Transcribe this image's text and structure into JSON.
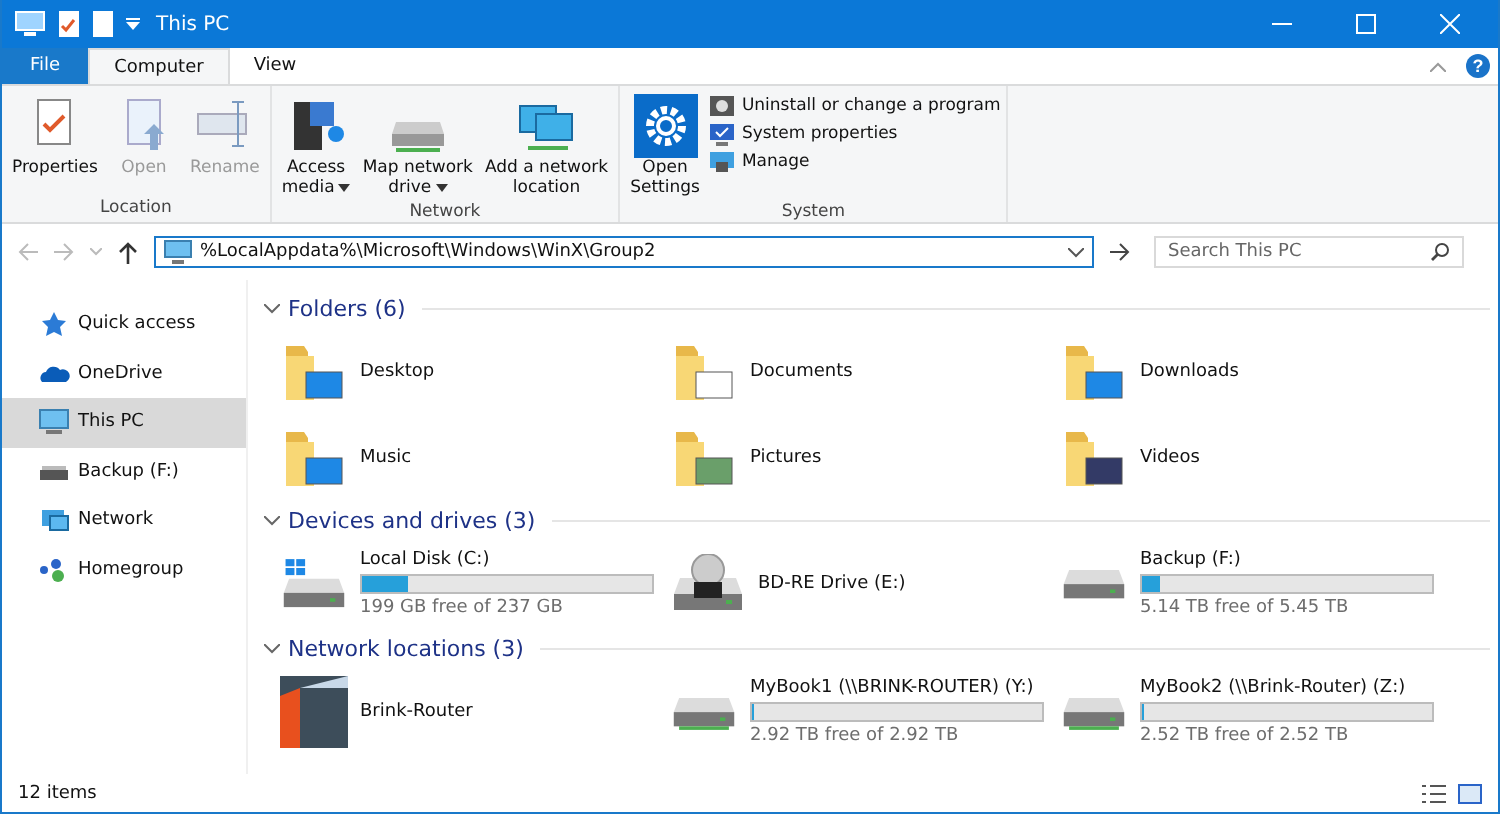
{
  "window": {
    "title": "This PC"
  },
  "ribbon_tabs": [
    {
      "label": "File",
      "selected": false,
      "kind": "file"
    },
    {
      "label": "Computer",
      "selected": true,
      "kind": "tab"
    },
    {
      "label": "View",
      "selected": false,
      "kind": "tab"
    }
  ],
  "help": {
    "label": "?"
  },
  "ribbon_groups": [
    {
      "name": "Location",
      "buttons": [
        {
          "lines": [
            "Properties"
          ],
          "disabled": false,
          "dropdown": false,
          "kind": "properties"
        },
        {
          "lines": [
            "Open"
          ],
          "disabled": true,
          "dropdown": false,
          "kind": "open"
        },
        {
          "lines": [
            "Rename"
          ],
          "disabled": true,
          "dropdown": false,
          "kind": "rename"
        }
      ]
    },
    {
      "name": "Network",
      "buttons": [
        {
          "lines": [
            "Access",
            "media"
          ],
          "disabled": false,
          "dropdown": true,
          "kind": "media"
        },
        {
          "lines": [
            "Map network",
            "drive"
          ],
          "disabled": false,
          "dropdown": true,
          "kind": "map"
        },
        {
          "lines": [
            "Add a network",
            "location"
          ],
          "disabled": false,
          "dropdown": false,
          "kind": "addnet"
        }
      ]
    },
    {
      "name": "System",
      "buttons": [
        {
          "lines": [
            "Open",
            "Settings"
          ],
          "disabled": false,
          "dropdown": false,
          "kind": "settings"
        }
      ],
      "small_buttons": [
        {
          "label": "Uninstall or change a program",
          "kind": "uninstall"
        },
        {
          "label": "System properties",
          "kind": "sysprops"
        },
        {
          "label": "Manage",
          "kind": "manage"
        }
      ]
    }
  ],
  "address": {
    "value": "%LocalAppdata%\\Microsoft\\Windows\\WinX\\Group2"
  },
  "search": {
    "placeholder": "Search This PC"
  },
  "sidebar": {
    "items": [
      {
        "label": "Quick access",
        "selected": false,
        "kind": "star"
      },
      {
        "label": "OneDrive",
        "selected": false,
        "kind": "cloud"
      },
      {
        "label": "This PC",
        "selected": true,
        "kind": "pc"
      },
      {
        "label": "Backup (F:)",
        "selected": false,
        "kind": "drive"
      },
      {
        "label": "Network",
        "selected": false,
        "kind": "network"
      },
      {
        "label": "Homegroup",
        "selected": false,
        "kind": "homegroup"
      }
    ]
  },
  "sections": [
    {
      "title": "Folders (6)",
      "items": [
        {
          "name": "Desktop",
          "kind": "folder"
        },
        {
          "name": "Documents",
          "kind": "folder"
        },
        {
          "name": "Downloads",
          "kind": "folder"
        },
        {
          "name": "Music",
          "kind": "folder"
        },
        {
          "name": "Pictures",
          "kind": "folder"
        },
        {
          "name": "Videos",
          "kind": "folder"
        }
      ]
    },
    {
      "title": "Devices and drives (3)",
      "items": [
        {
          "name": "Local Disk (C:)",
          "kind": "system-drive",
          "level": 0.16,
          "free": "199 GB free of 237 GB"
        },
        {
          "name": "BD-RE Drive (E:)",
          "kind": "optical"
        },
        {
          "name": "Backup (F:)",
          "kind": "drive",
          "level": 0.06,
          "free": "5.14 TB free of 5.45 TB"
        }
      ]
    },
    {
      "title": "Network locations (3)",
      "items": [
        {
          "name": "Brink-Router",
          "kind": "router"
        },
        {
          "name": "MyBook1 (\\\\BRINK-ROUTER) (Y:)",
          "kind": "network-drive",
          "level": 0,
          "free": "2.92 TB free of 2.92 TB"
        },
        {
          "name": "MyBook2 (\\\\Brink-Router) (Z:)",
          "kind": "network-drive",
          "level": 0,
          "free": "2.52 TB free of 2.52 TB"
        }
      ]
    }
  ],
  "status_bar": {
    "text": "12 items"
  }
}
